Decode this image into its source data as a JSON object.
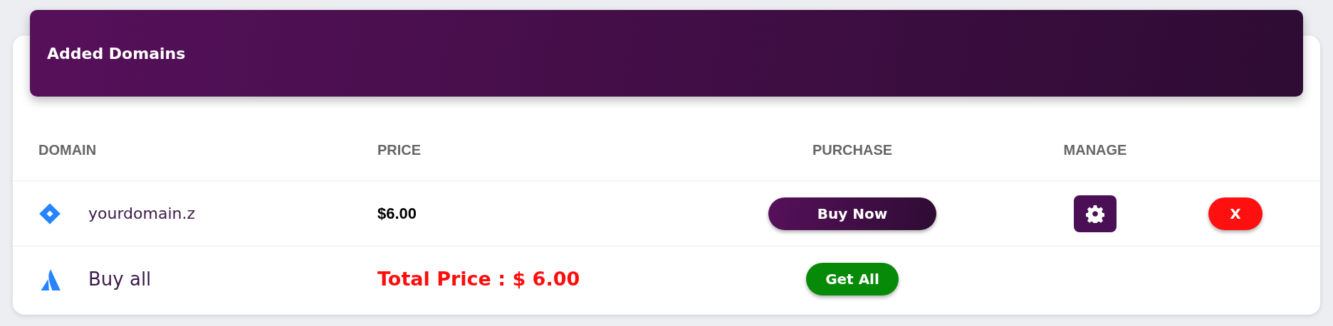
{
  "header": {
    "title": "Added Domains"
  },
  "table": {
    "columns": [
      "DOMAIN",
      "PRICE",
      "PURCHASE",
      "MANAGE"
    ],
    "rows": [
      {
        "kind": "domain",
        "name": "yourdomain.z",
        "price": "$6.00",
        "purchase": "Buy Now",
        "remove": "X"
      },
      {
        "kind": "total",
        "name": "Buy all",
        "price": "Total Price : $ 6.00",
        "purchase": "Get All"
      }
    ]
  }
}
